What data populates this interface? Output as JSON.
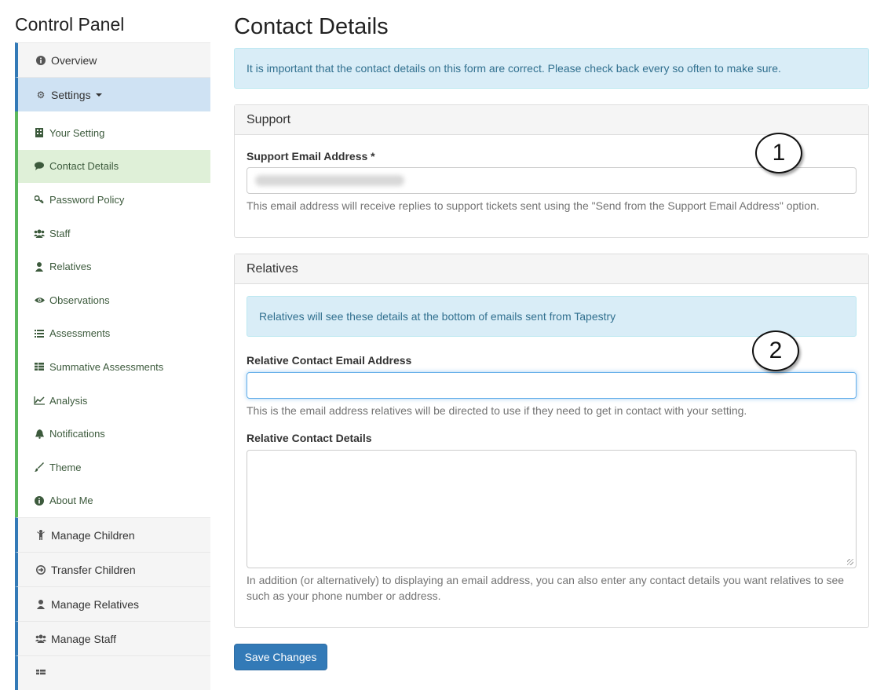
{
  "sidebar": {
    "title": "Control Panel",
    "top_items": [
      {
        "label": "Overview",
        "icon": "info-circle-icon"
      },
      {
        "label": "Settings",
        "icon": "gear-icon"
      }
    ],
    "sub_items": [
      {
        "label": "Your Setting",
        "icon": "building-icon"
      },
      {
        "label": "Contact Details",
        "icon": "speech-bubble-icon"
      },
      {
        "label": "Password Policy",
        "icon": "key-icon"
      },
      {
        "label": "Staff",
        "icon": "users-icon"
      },
      {
        "label": "Relatives",
        "icon": "user-icon"
      },
      {
        "label": "Observations",
        "icon": "eye-icon"
      },
      {
        "label": "Assessments",
        "icon": "list-icon"
      },
      {
        "label": "Summative Assessments",
        "icon": "th-list-icon"
      },
      {
        "label": "Analysis",
        "icon": "line-chart-icon"
      },
      {
        "label": "Notifications",
        "icon": "bell-icon"
      },
      {
        "label": "Theme",
        "icon": "brush-icon"
      },
      {
        "label": "About Me",
        "icon": "info-circle-icon"
      }
    ],
    "bottom_items": [
      {
        "label": "Manage Children",
        "icon": "child-icon"
      },
      {
        "label": "Transfer Children",
        "icon": "arrow-circle-icon"
      },
      {
        "label": "Manage Relatives",
        "icon": "user-icon"
      },
      {
        "label": "Manage Staff",
        "icon": "users-icon"
      }
    ]
  },
  "main": {
    "title": "Contact Details",
    "top_alert": "It is important that the contact details on this form are correct. Please check back every so often to make sure.",
    "support_panel": {
      "heading": "Support",
      "email_label": "Support Email Address *",
      "email_help": "This email address will receive replies to support tickets sent using the \"Send from the Support Email Address\" option.",
      "callout": "1"
    },
    "relatives_panel": {
      "heading": "Relatives",
      "alert": "Relatives will see these details at the bottom of emails sent from Tapestry",
      "email_label": "Relative Contact Email Address",
      "email_value": "",
      "email_help": "This is the email address relatives will be directed to use if they need to get in contact with your setting.",
      "details_label": "Relative Contact Details",
      "details_value": "",
      "details_help": "In addition (or alternatively) to displaying an email address, you can also enter any contact details you want relatives to see such as your phone number or address.",
      "callout": "2"
    },
    "save_label": "Save Changes"
  }
}
